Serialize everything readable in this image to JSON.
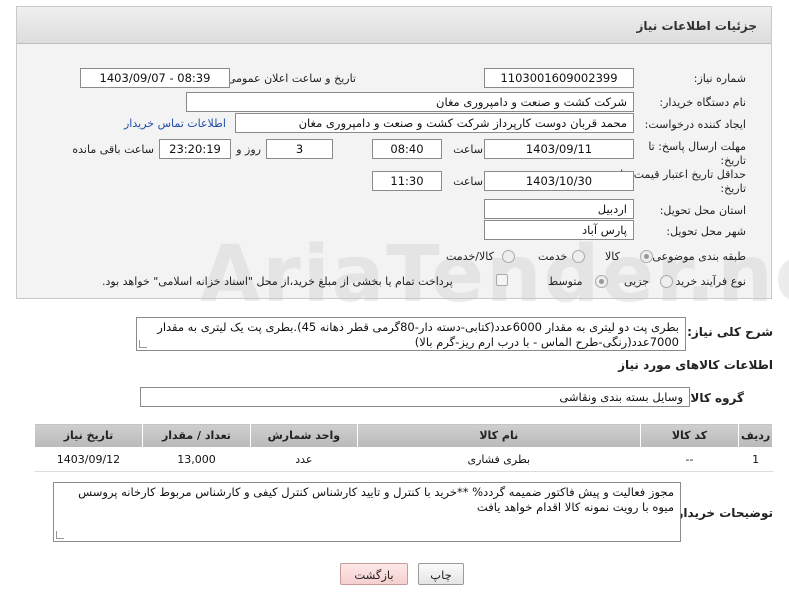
{
  "header": {
    "title": "جزئیات اطلاعات نیاز"
  },
  "fields": {
    "need_number_label": "شماره نیاز:",
    "need_number": "1103001609002399",
    "announce_label": "تاریخ و ساعت اعلان عمومی:",
    "announce_value": "1403/09/07 - 08:39",
    "buyer_org_label": "نام دستگاه خریدار:",
    "buyer_org": "شرکت کشت و صنعت و دامپروری مغان",
    "creator_label": "ایجاد کننده درخواست:",
    "creator": "محمد قربان دوست کارپرداز شرکت کشت و صنعت و دامپروری مغان",
    "contact_link": "اطلاعات تماس خریدار",
    "reply_deadline_label": "مهلت ارسال پاسخ: تا تاریخ:",
    "reply_date": "1403/09/11",
    "time_label": "ساعت",
    "reply_time": "08:40",
    "days_value": "3",
    "days_label": "روز و",
    "remaining_time": "23:20:19",
    "remaining_label": "ساعت باقی مانده",
    "price_validity_label": "حداقل تاریخ اعتبار قیمت: تا تاریخ:",
    "price_date": "1403/10/30",
    "price_time": "11:30",
    "province_label": "استان محل تحویل:",
    "province": "اردبیل",
    "city_label": "شهر محل تحویل:",
    "city": "پارس آباد",
    "category_label": "طبقه بندی موضوعی:",
    "category_options": [
      "کالا",
      "خدمت",
      "کالا/خدمت"
    ],
    "process_label": "نوع فرآیند خرید :",
    "process_options": [
      "جزیی",
      "متوسط"
    ],
    "payment_note": "پرداخت تمام یا بخشی از مبلغ خرید،از محل \"اسناد خزانه اسلامی\" خواهد بود."
  },
  "description": {
    "label": "شرح کلی نیاز:",
    "text": "بطری پت دو لیتری به مقدار 6000عدد(کتابی-دسته دار-80گرمی قطر دهانه 45).بطری پت یک لیتری به مقدار 7000عدد(رنگی-طرح الماس - با درب ارم ریز-گرم بالا)"
  },
  "goods": {
    "section_title": "اطلاعات کالاهای مورد نیاز",
    "group_label": "گروه کالا:",
    "group_value": "وسایل بسته بندی  ونقاشی",
    "columns": [
      "ردیف",
      "کد کالا",
      "نام کالا",
      "واحد شمارش",
      "تعداد / مقدار",
      "تاریخ نیاز"
    ],
    "rows": [
      [
        "1",
        "--",
        "بطری فشاری",
        "عدد",
        "13,000",
        "1403/09/12"
      ]
    ]
  },
  "buyer_notes": {
    "label": "توضیحات خریدار:",
    "text": "مجوز فعالیت و پیش فاکتور ضمیمه گردد% **خرید با کنترل و تایید کارشناس کنترل کیفی و کارشناس مربوط کارخانه پروسس میوه با رویت نمونه کالا اقدام خواهد یافت"
  },
  "buttons": {
    "print": "چاپ",
    "back": "بازگشت"
  },
  "watermark": "AriaTender.net"
}
